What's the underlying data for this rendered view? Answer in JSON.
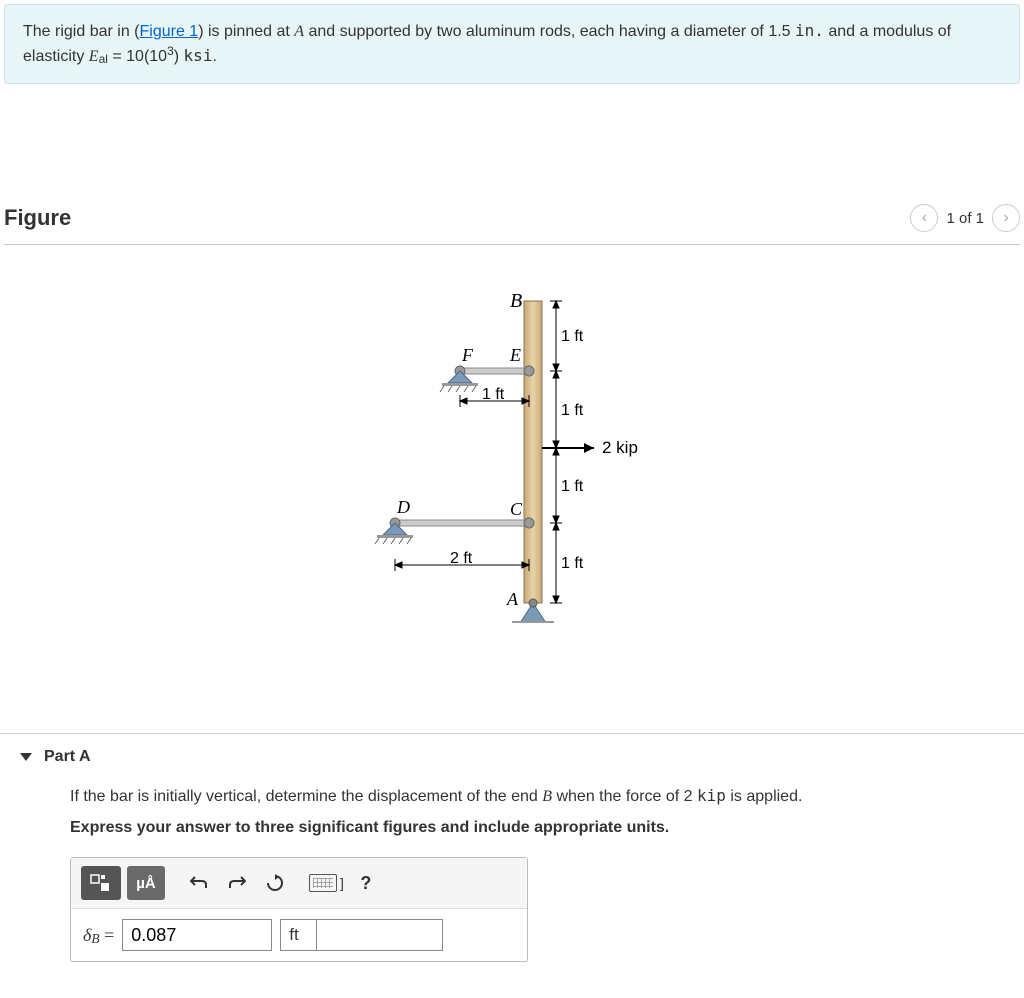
{
  "problem": {
    "text_prefix": "The rigid bar in (",
    "figure_link_text": "Figure 1",
    "text_mid": ") is pinned at ",
    "var_A": "A",
    "text_after_A": " and supported by two aluminum rods, each having a diameter of 1.5 ",
    "unit_in": "in.",
    "text_and": " and a modulus of elasticity ",
    "var_E": "E",
    "var_E_sub": "al",
    "equals": " = ",
    "val_10": "10(10",
    "val_exp": "3",
    "val_close": ") ",
    "unit_ksi": "ksi",
    "text_end": "."
  },
  "figure": {
    "title": "Figure",
    "nav_text": "1 of 1",
    "labels": {
      "B": "B",
      "F": "F",
      "E": "E",
      "D": "D",
      "C": "C",
      "A": "A",
      "dim_1ft": "1 ft",
      "dim_2ft": "2 ft",
      "load": "2 kip"
    }
  },
  "partA": {
    "title": "Part A",
    "question_prefix": "If the bar is initially vertical, determine the displacement of the end ",
    "var_B": "B",
    "question_mid": " when the force of 2 ",
    "unit_kip": "kip",
    "question_suffix": " is applied.",
    "instruction": "Express your answer to three significant figures and include appropriate units.",
    "toolbar": {
      "template_icon": "▭",
      "units_label": "µÅ",
      "undo": "↶",
      "redo": "↷",
      "reset": "↻",
      "keyboard": "⌨",
      "bracket": "]",
      "help": "?"
    },
    "answer": {
      "symbol": "δ",
      "symbol_sub": "B",
      "equals": " = ",
      "value": "0.087",
      "unit": "ft"
    }
  }
}
